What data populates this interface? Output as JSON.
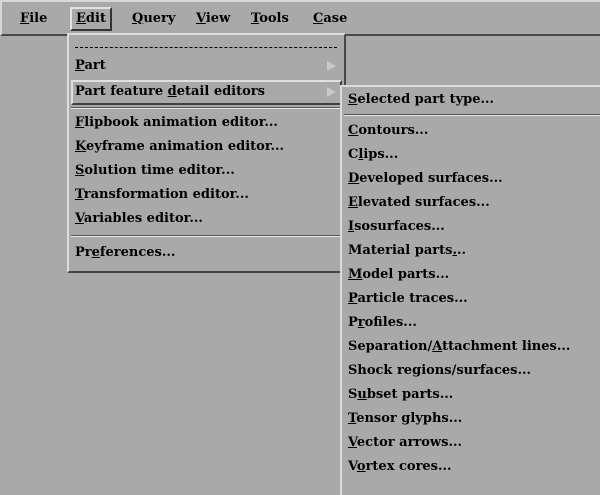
{
  "menubar": {
    "items": [
      {
        "pre": "",
        "key": "F",
        "post": "ile"
      },
      {
        "pre": "",
        "key": "E",
        "post": "dit"
      },
      {
        "pre": "",
        "key": "Q",
        "post": "uery"
      },
      {
        "pre": "",
        "key": "V",
        "post": "iew"
      },
      {
        "pre": "",
        "key": "T",
        "post": "ools"
      },
      {
        "pre": "",
        "key": "C",
        "post": "ase"
      }
    ]
  },
  "edit_menu": {
    "items": [
      {
        "pre": "",
        "key": "P",
        "post": "art"
      },
      {
        "pre": "Part feature ",
        "key": "d",
        "post": "etail editors"
      },
      {
        "pre": "",
        "key": "F",
        "post": "lipbook animation editor..."
      },
      {
        "pre": "",
        "key": "K",
        "post": "eyframe animation editor..."
      },
      {
        "pre": "",
        "key": "S",
        "post": "olution time editor..."
      },
      {
        "pre": "",
        "key": "T",
        "post": "ransformation editor..."
      },
      {
        "pre": "",
        "key": "V",
        "post": "ariables editor..."
      },
      {
        "pre": "Pr",
        "key": "e",
        "post": "ferences..."
      }
    ]
  },
  "submenu": {
    "items": [
      {
        "pre": "",
        "key": "S",
        "post": "elected part type..."
      },
      {
        "pre": "",
        "key": "C",
        "post": "ontours..."
      },
      {
        "pre": "C",
        "key": "l",
        "post": "ips..."
      },
      {
        "pre": "",
        "key": "D",
        "post": "eveloped surfaces..."
      },
      {
        "pre": "",
        "key": "E",
        "post": "levated surfaces..."
      },
      {
        "pre": "",
        "key": "I",
        "post": "sosurfaces..."
      },
      {
        "pre": "Material parts",
        "key": ".",
        "post": ".."
      },
      {
        "pre": "",
        "key": "M",
        "post": "odel parts..."
      },
      {
        "pre": "",
        "key": "P",
        "post": "article traces..."
      },
      {
        "pre": "P",
        "key": "r",
        "post": "ofiles..."
      },
      {
        "pre": "Separation/",
        "key": "A",
        "post": "ttachment lines..."
      },
      {
        "pre": "Shock re",
        "key": "g",
        "post": "ions/surfaces..."
      },
      {
        "pre": "S",
        "key": "u",
        "post": "bset parts..."
      },
      {
        "pre": "",
        "key": "T",
        "post": "ensor glyphs..."
      },
      {
        "pre": "",
        "key": "V",
        "post": "ector arrows..."
      },
      {
        "pre": "V",
        "key": "o",
        "post": "rtex cores..."
      }
    ]
  }
}
